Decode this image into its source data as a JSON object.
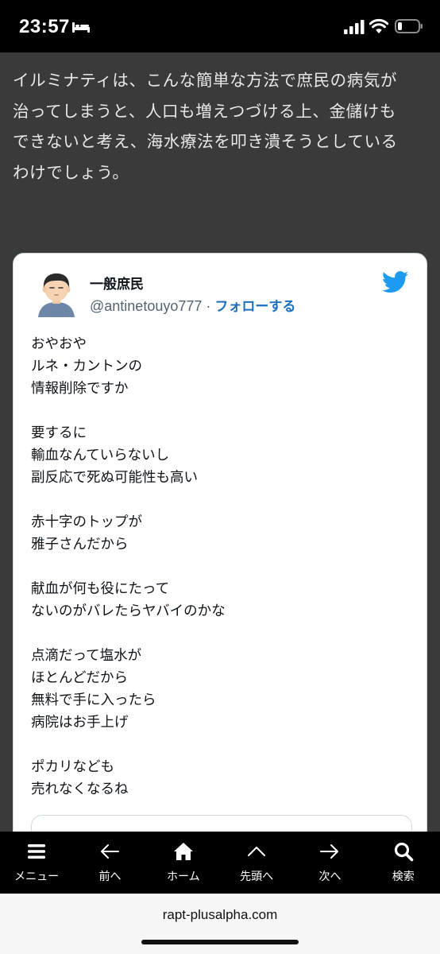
{
  "status_bar": {
    "time": "23:57"
  },
  "article": {
    "lines": [
      "イルミナティは、こんな簡単な方法で庶民の病気が",
      "治ってしまうと、人口も増えつづける上、金儲けも",
      "できないと考え、海水療法を叩き潰そうとしている",
      "わけでしょう。"
    ]
  },
  "tweet": {
    "display_name": "一般庶民",
    "handle": "@antinetouyo777",
    "separator": " · ",
    "follow_label": "フォローする",
    "text": "おやおや\nルネ・カントンの\n情報削除ですか\n\n要するに\n輸血なんていらないし\n副反応で死ぬ可能性も高い\n\n赤十字のトップが\n雅子さんだから\n\n献血が何も役にたって\nないのがバレたらヤバイのかな\n\n点滴だって塩水が\nほとんどだから\n無料で手に入ったら\n病院はお手上げ\n\nポカリなども\n売れなくなるね"
  },
  "bottom_nav": {
    "items": [
      {
        "label": "メニュー",
        "icon": "menu-icon"
      },
      {
        "label": "前へ",
        "icon": "arrow-left-icon"
      },
      {
        "label": "ホーム",
        "icon": "home-icon"
      },
      {
        "label": "先頭へ",
        "icon": "chevron-up-icon"
      },
      {
        "label": "次へ",
        "icon": "arrow-right-icon"
      },
      {
        "label": "検索",
        "icon": "search-icon"
      }
    ]
  },
  "browser": {
    "url": "rapt-plusalpha.com"
  },
  "colors": {
    "page_background": "#3a3a3a",
    "follow_link": "#1d6fbf",
    "twitter_blue": "#1d9bf0"
  }
}
